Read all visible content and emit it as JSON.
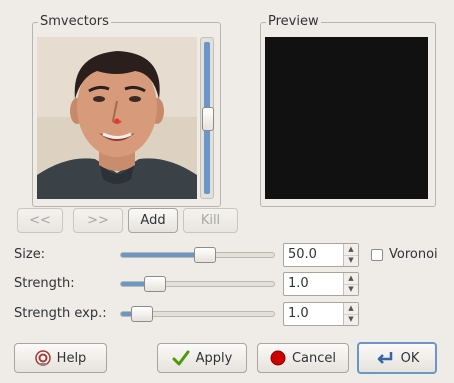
{
  "smvectors": {
    "title": "Smvectors",
    "scroll_level": 0.48
  },
  "preview": {
    "title": "Preview"
  },
  "nav_buttons": {
    "prev": "<<",
    "next": ">>",
    "add": "Add",
    "kill": "Kill"
  },
  "controls": [
    {
      "label": "Size:",
      "value": "50.0",
      "level": 0.55
    },
    {
      "label": "Strength:",
      "value": "1.0",
      "level": 0.22
    },
    {
      "label": "Strength exp.:",
      "value": "1.0",
      "level": 0.14
    }
  ],
  "voronoi": {
    "label": "Voronoi",
    "checked": false
  },
  "footer": {
    "help": "Help",
    "apply": "Apply",
    "cancel": "Cancel",
    "ok": "OK"
  },
  "colors": {
    "accent": "#6a96c8",
    "apply_check": "#4e9a06",
    "cancel_red": "#cc0000",
    "marker": "#ff2a2a"
  }
}
